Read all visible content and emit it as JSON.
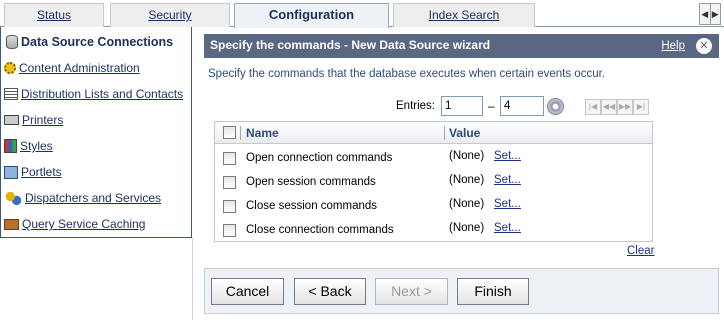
{
  "tabs": [
    {
      "label": "Status"
    },
    {
      "label": "Security"
    },
    {
      "label": "Configuration",
      "active": true
    },
    {
      "label": "Index Search"
    }
  ],
  "nav": {
    "items": [
      {
        "label": "Data Source Connections",
        "icon": "database-icon",
        "selected": true
      },
      {
        "label": "Content Administration",
        "icon": "gears-icon"
      },
      {
        "label": "Distribution Lists and Contacts",
        "icon": "distribution-list-icon"
      },
      {
        "label": "Printers",
        "icon": "printer-icon"
      },
      {
        "label": "Styles",
        "icon": "styles-icon"
      },
      {
        "label": "Portlets",
        "icon": "portlet-icon"
      },
      {
        "label": "Dispatchers and Services",
        "icon": "dispatchers-icon"
      },
      {
        "label": "Query Service Caching",
        "icon": "cache-icon"
      }
    ]
  },
  "wizard": {
    "title": "Specify the commands - New Data Source wizard",
    "help_label": "Help",
    "description": "Specify the commands that the database executes when certain events occur.",
    "entries_label": "Entries:",
    "entries_from": "1",
    "entries_dash": "–",
    "entries_to": "4",
    "columns": {
      "name": "Name",
      "value": "Value"
    },
    "rows": [
      {
        "name": "Open connection commands",
        "value": "(None)",
        "action": "Set..."
      },
      {
        "name": "Open session commands",
        "value": "(None)",
        "action": "Set..."
      },
      {
        "name": "Close session commands",
        "value": "(None)",
        "action": "Set..."
      },
      {
        "name": "Close connection commands",
        "value": "(None)",
        "action": "Set..."
      }
    ],
    "clear_label": "Clear",
    "buttons": {
      "cancel": "Cancel",
      "back": "< Back",
      "next": "Next >",
      "finish": "Finish"
    }
  },
  "colors": {
    "header_bg": "#5a6782",
    "link": "#1b2f5b"
  }
}
